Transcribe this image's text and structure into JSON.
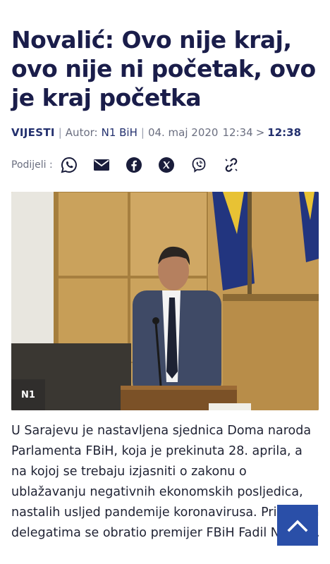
{
  "article": {
    "title": "Novalić: Ovo nije kraj, ovo nije ni početak, ovo je kraj početka",
    "category": "VIJESTI",
    "author_label": "Autor:",
    "author": "N1 BiH",
    "date": "04. maj 2020",
    "published_time": "12:34",
    "time_arrow": ">",
    "updated_time": "12:38",
    "share_label": "Podijeli :",
    "image_badge": "N1",
    "body": "U Sarajevu je nastavljena sjednica Doma naroda Parlamenta FBiH, koja je prekinuta 28. aprila, a na kojoj se trebaju izjasniti o zakonu o ublažavanju negativnih ekonomskih posljedica, nastalih usljed pandemije koronavirusa. Prisutnim delegatima se obratio premijer FBiH Fadil Novalić."
  },
  "share_icons": [
    "whatsapp-icon",
    "email-icon",
    "facebook-icon",
    "x-icon",
    "viber-icon",
    "link-icon"
  ],
  "colors": {
    "headline": "#1a1d4a",
    "accent": "#23306e",
    "fab": "#2a4fa8",
    "muted": "#6b6f80"
  }
}
